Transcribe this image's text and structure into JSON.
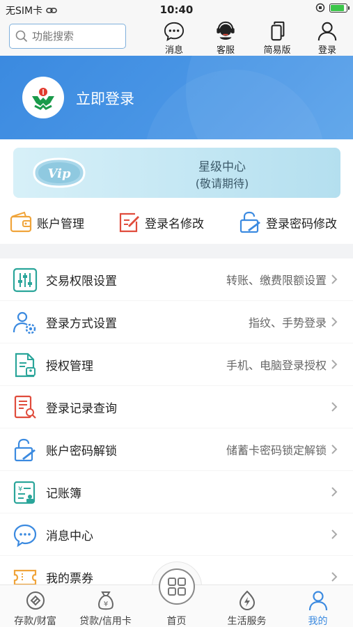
{
  "status_bar": {
    "carrier": "无SIM卡",
    "time": "10:40",
    "battery_level": 0.85
  },
  "toolbar": {
    "search_placeholder": "功能搜索",
    "buttons": [
      {
        "label": "消息",
        "icon": "message-icon"
      },
      {
        "label": "客服",
        "icon": "customer-service-icon"
      },
      {
        "label": "简易版",
        "icon": "simple-version-icon"
      },
      {
        "label": "登录",
        "icon": "user-icon"
      }
    ]
  },
  "hero": {
    "login_label": "立即登录",
    "logo": "abc-bank-logo"
  },
  "vip": {
    "badge": "Vip",
    "title": "星级中心",
    "subtitle": "(敬请期待)"
  },
  "quick_actions": [
    {
      "label": "账户管理",
      "icon": "wallet-icon"
    },
    {
      "label": "登录名修改",
      "icon": "edit-icon"
    },
    {
      "label": "登录密码修改",
      "icon": "lock-icon"
    }
  ],
  "settings": [
    {
      "title": "交易权限设置",
      "desc": "转账、缴费限额设置",
      "icon": "sliders-icon"
    },
    {
      "title": "登录方式设置",
      "desc": "指纹、手势登录",
      "icon": "user-gear-icon"
    },
    {
      "title": "授权管理",
      "desc": "手机、电脑登录授权",
      "icon": "document-icon"
    },
    {
      "title": "登录记录查询",
      "desc": "",
      "icon": "record-search-icon"
    },
    {
      "title": "账户密码解锁",
      "desc": "储蓄卡密码锁定解锁",
      "icon": "unlock-icon"
    },
    {
      "title": "记账簿",
      "desc": "",
      "icon": "ledger-icon"
    },
    {
      "title": "消息中心",
      "desc": "",
      "icon": "chat-icon"
    },
    {
      "title": "我的票券",
      "desc": "",
      "icon": "ticket-icon"
    }
  ],
  "tabbar": [
    {
      "label": "存款/财富",
      "icon": "deposit-icon"
    },
    {
      "label": "贷款/信用卡",
      "icon": "loan-icon"
    },
    {
      "label": "首页",
      "icon": "home-grid-icon"
    },
    {
      "label": "生活服务",
      "icon": "life-service-icon"
    },
    {
      "label": "我的",
      "icon": "profile-icon",
      "active": true
    }
  ],
  "colors": {
    "accent": "#3b8ae0",
    "teal": "#2aa59a",
    "red": "#e04c3c",
    "orange": "#f0a43a"
  }
}
